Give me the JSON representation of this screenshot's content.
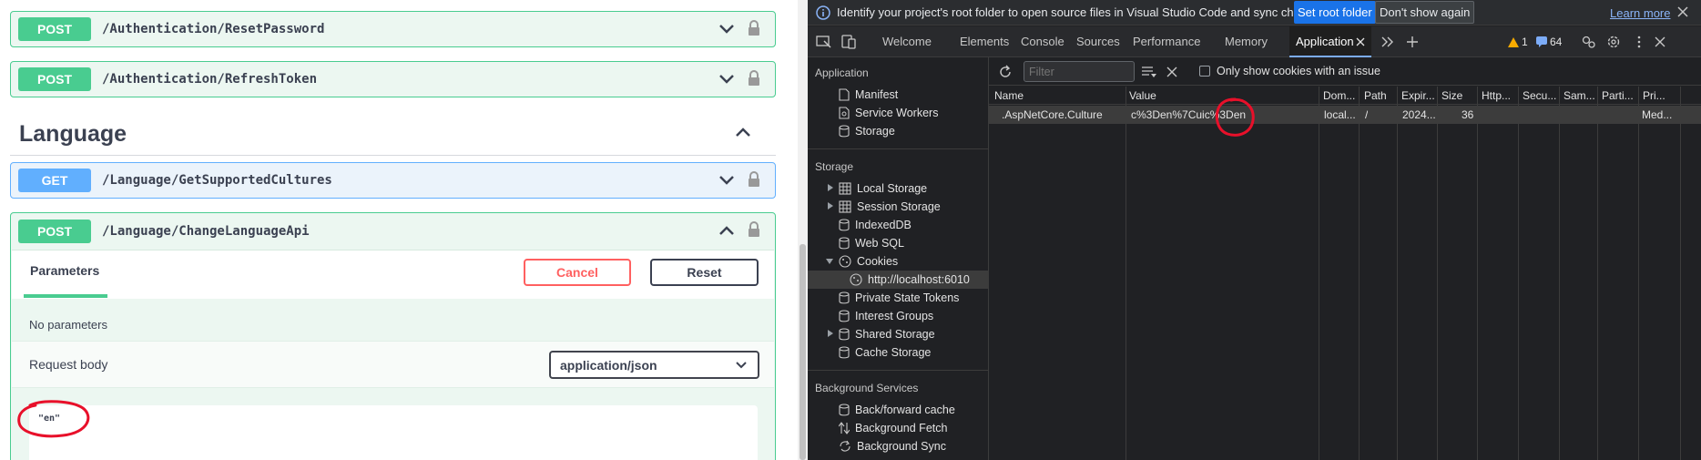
{
  "swagger": {
    "operations": [
      {
        "method": "POST",
        "path": "/Authentication/ResetPassword"
      },
      {
        "method": "POST",
        "path": "/Authentication/RefreshToken"
      }
    ],
    "section": {
      "title": "Language"
    },
    "language_ops": [
      {
        "method": "GET",
        "path": "/Language/GetSupportedCultures"
      }
    ],
    "open_op": {
      "method": "POST",
      "path": "/Language/ChangeLanguageApi",
      "tab_label": "Parameters",
      "cancel_label": "Cancel",
      "reset_label": "Reset",
      "no_params_text": "No parameters",
      "request_body_label": "Request body",
      "content_type": "application/json",
      "body_value": "\"en\""
    }
  },
  "devtools": {
    "infobar": {
      "message": "Identify your project's root folder to open source files in Visual Studio Code and sync changes.",
      "primary_button": "Set root folder",
      "secondary_button": "Don't show again",
      "learn_more": "Learn more"
    },
    "tabs": [
      "Welcome",
      "Elements",
      "Console",
      "Sources",
      "Performance",
      "Memory",
      "Application"
    ],
    "active_tab": "Application",
    "warnings_count": "1",
    "messages_count": "64",
    "sidebar": {
      "application_heading": "Application",
      "application_items": [
        "Manifest",
        "Service Workers",
        "Storage"
      ],
      "storage_heading": "Storage",
      "storage_items": [
        "Local Storage",
        "Session Storage",
        "IndexedDB",
        "Web SQL",
        "Cookies"
      ],
      "cookie_origin": "http://localhost:6010",
      "more_storage_items": [
        "Private State Tokens",
        "Interest Groups",
        "Shared Storage",
        "Cache Storage"
      ],
      "background_heading": "Background Services",
      "background_items": [
        "Back/forward cache",
        "Background Fetch",
        "Background Sync"
      ]
    },
    "filter": {
      "placeholder": "Filter",
      "only_issues_label": "Only show cookies with an issue"
    },
    "columns": [
      "Name",
      "Value",
      "Dom...",
      "Path",
      "Expir...",
      "Size",
      "Http...",
      "Secu...",
      "Sam...",
      "Parti...",
      "Pri..."
    ],
    "cookie_row": {
      "name": ".AspNetCore.Culture",
      "value": "c%3Den%7Cuic%3Den",
      "domain": "local...",
      "path": "/",
      "expires": "2024...",
      "size": "36",
      "priority": "Med..."
    },
    "colors": {
      "accent": "#7cacf8",
      "primary_button": "#1a73e8",
      "annotation": "#e8102a"
    }
  },
  "swagger_colors": {
    "post": "#49cc90",
    "get": "#61affe",
    "cancel": "#ff6060"
  }
}
